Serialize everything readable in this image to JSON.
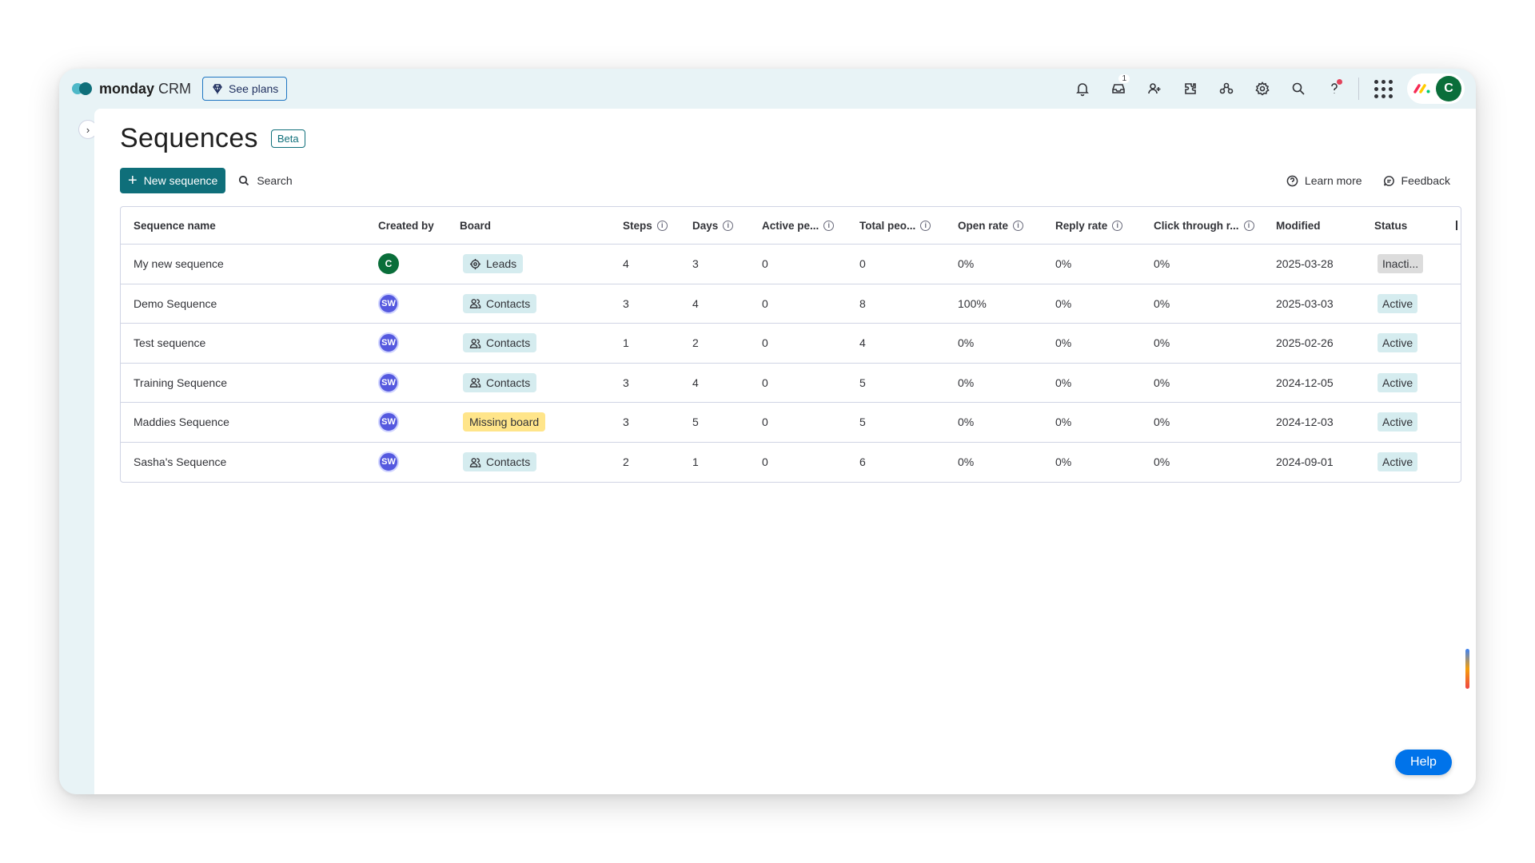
{
  "app": {
    "brand": "monday",
    "product": "CRM",
    "see_plans": "See plans"
  },
  "topbar": {
    "inbox_count": "1",
    "icons": [
      "bell-icon",
      "inbox-icon",
      "invite-icon",
      "integrations-icon",
      "marketplace-icon",
      "settings-icon",
      "search-icon",
      "help-icon",
      "apps-grid-icon"
    ],
    "avatar_initial": "C"
  },
  "page": {
    "title": "Sequences",
    "badge": "Beta",
    "new_button": "New sequence",
    "search_label": "Search",
    "learn_more": "Learn more",
    "feedback": "Feedback"
  },
  "table": {
    "headers": {
      "name": "Sequence name",
      "creator": "Created by",
      "board": "Board",
      "steps": "Steps",
      "days": "Days",
      "active": "Active pe...",
      "total": "Total peo...",
      "open": "Open rate",
      "reply": "Reply rate",
      "click": "Click through r...",
      "modified": "Modified",
      "status": "Status"
    },
    "rows": [
      {
        "name": "My new sequence",
        "creator": "C",
        "board": "Leads",
        "steps": "4",
        "days": "3",
        "active": "0",
        "total": "0",
        "open": "0%",
        "reply": "0%",
        "click": "0%",
        "modified": "2025-03-28",
        "status": "Inacti..."
      },
      {
        "name": "Demo Sequence",
        "creator": "SW",
        "board": "Contacts",
        "steps": "3",
        "days": "4",
        "active": "0",
        "total": "8",
        "open": "100%",
        "reply": "0%",
        "click": "0%",
        "modified": "2025-03-03",
        "status": "Active"
      },
      {
        "name": "Test sequence",
        "creator": "SW",
        "board": "Contacts",
        "steps": "1",
        "days": "2",
        "active": "0",
        "total": "4",
        "open": "0%",
        "reply": "0%",
        "click": "0%",
        "modified": "2025-02-26",
        "status": "Active"
      },
      {
        "name": "Training Sequence",
        "creator": "SW",
        "board": "Contacts",
        "steps": "3",
        "days": "4",
        "active": "0",
        "total": "5",
        "open": "0%",
        "reply": "0%",
        "click": "0%",
        "modified": "2024-12-05",
        "status": "Active"
      },
      {
        "name": "Maddies Sequence",
        "creator": "SW",
        "board": "Missing board",
        "steps": "3",
        "days": "5",
        "active": "0",
        "total": "5",
        "open": "0%",
        "reply": "0%",
        "click": "0%",
        "modified": "2024-12-03",
        "status": "Active"
      },
      {
        "name": "Sasha's Sequence",
        "creator": "SW",
        "board": "Contacts",
        "steps": "2",
        "days": "1",
        "active": "0",
        "total": "6",
        "open": "0%",
        "reply": "0%",
        "click": "0%",
        "modified": "2024-09-01",
        "status": "Active"
      }
    ]
  },
  "help_button": "Help",
  "colors": {
    "accent": "#0f6f7a",
    "help": "#0073ea",
    "active_tag": "#d5ecef",
    "missing_tag": "#ffe58a",
    "inactive_tag": "#dcdcdc",
    "creator_purple": "#5559df",
    "creator_green": "#0a6e3a"
  }
}
